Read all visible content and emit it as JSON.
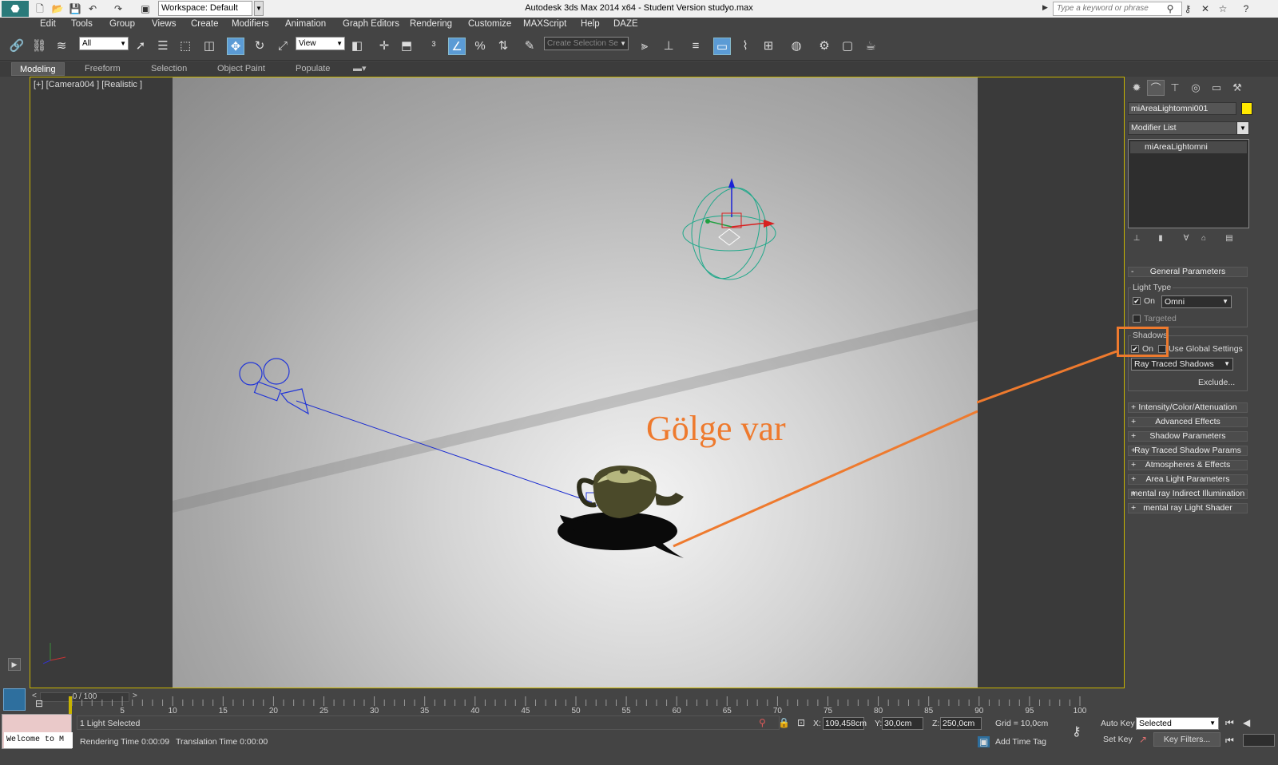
{
  "titlebar": {
    "workspace": "Workspace: Default",
    "title": "Autodesk 3ds Max  2014 x64  - Student Version    studyo.max",
    "search_placeholder": "Type a keyword or phrase"
  },
  "menu": [
    "Edit",
    "Tools",
    "Group",
    "Views",
    "Create",
    "Modifiers",
    "Animation",
    "Graph Editors",
    "Rendering",
    "Customize",
    "MAXScript",
    "Help",
    "DAZE"
  ],
  "toolbar": {
    "filter": "All",
    "ref_coord": "View",
    "selection_set": "Create Selection Se"
  },
  "ribbon": {
    "tabs": [
      "Modeling",
      "Freeform",
      "Selection",
      "Object Paint",
      "Populate"
    ]
  },
  "viewport": {
    "label": "[+] [Camera004 ] [Realistic ]",
    "annotation": "Gölge var",
    "annotation_color": "#ee7a2e"
  },
  "command_panel": {
    "object_name": "miAreaLightomni001",
    "object_color": "#ffe800",
    "modifier_list": "Modifier List",
    "stack_item": "miAreaLightomni",
    "general_parameters": {
      "title": "General Parameters",
      "light_type_group": "Light Type",
      "light_on_label": "On",
      "light_on": true,
      "light_type": "Omni",
      "targeted_label": "Targeted",
      "targeted": false,
      "shadows_group": "Shadows",
      "shadows_on_label": "On",
      "shadows_on": true,
      "use_global_label": "Use Global Settings",
      "use_global": false,
      "shadow_type": "Ray Traced Shadows",
      "exclude": "Exclude..."
    },
    "rollouts": [
      "Intensity/Color/Attenuation",
      "Advanced Effects",
      "Shadow Parameters",
      "Ray Traced Shadow Params",
      "Atmospheres & Effects",
      "Area Light Parameters",
      "mental ray Indirect Illumination",
      "mental ray Light Shader"
    ]
  },
  "timeline": {
    "slider": "0 / 100",
    "ticks": [
      "5",
      "10",
      "15",
      "20",
      "25",
      "30",
      "35",
      "40",
      "45",
      "50",
      "55",
      "60",
      "65",
      "70",
      "75",
      "80",
      "85",
      "90",
      "95",
      "100"
    ]
  },
  "status": {
    "maxscript": "Welcome to M",
    "selection": "1 Light Selected",
    "rendering_time": "Rendering Time  0:00:09",
    "translation_time": "Translation Time  0:00:00",
    "x_label": "X:",
    "x": "109,458cm",
    "y_label": "Y:",
    "y": "30,0cm",
    "z_label": "Z:",
    "z": "250,0cm",
    "grid": "Grid = 10,0cm",
    "add_time_tag": "Add Time Tag",
    "auto_key": "Auto Key",
    "set_key": "Set Key",
    "selected": "Selected",
    "key_filters": "Key Filters..."
  }
}
